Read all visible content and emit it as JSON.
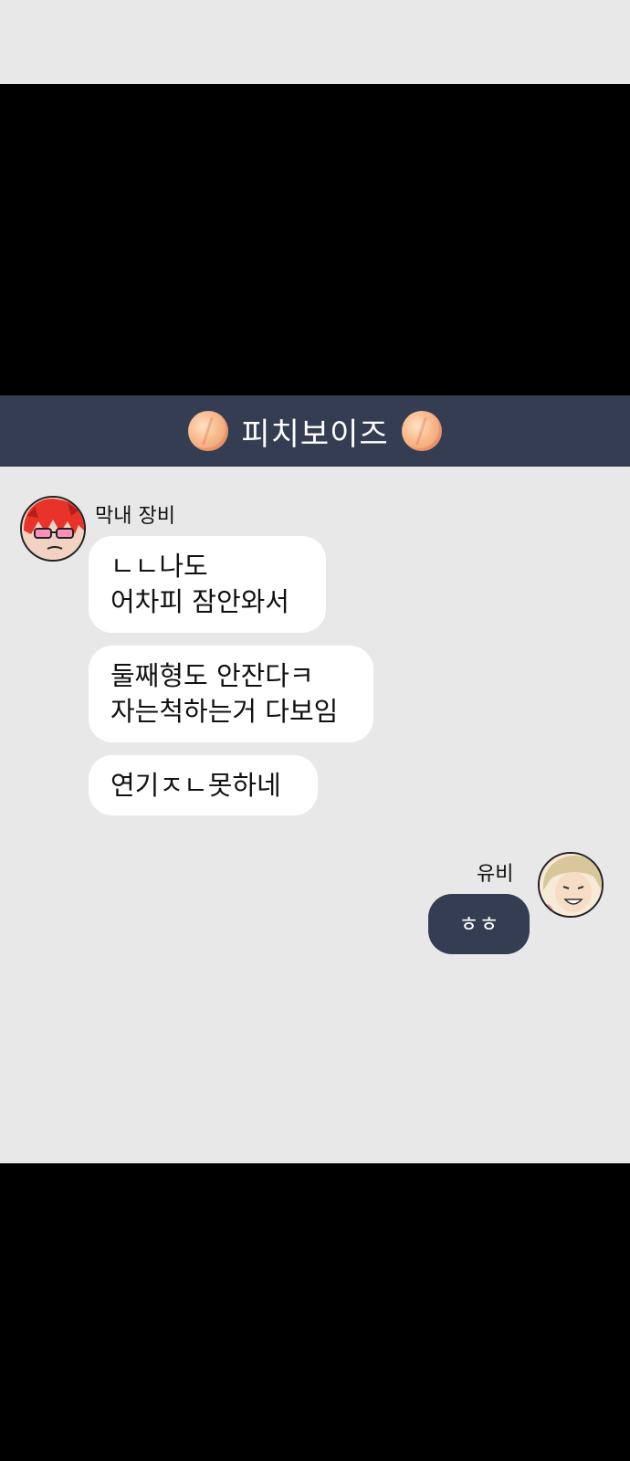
{
  "header": {
    "title": "피치보이즈",
    "icon_left": "peach-icon",
    "icon_right": "peach-icon",
    "background": "#353d52"
  },
  "messages": [
    {
      "sender": "막내 장비",
      "lines": [
        "ㄴㄴ나도",
        "어차피 잠안와서"
      ]
    },
    {
      "sender": "막내 장비",
      "lines": [
        "둘째형도 안잔다ㅋ",
        "자는척하는거 다보임"
      ]
    },
    {
      "sender": "막내 장비",
      "lines": [
        "연기ㅈㄴ못하네"
      ]
    },
    {
      "sender": "유비",
      "lines": [
        "ㅎㅎ"
      ]
    }
  ],
  "senders": {
    "left": "막내 장비",
    "right": "유비"
  },
  "colors": {
    "chat_background": "#e8e8e8",
    "incoming_bubble": "#ffffff",
    "outgoing_bubble": "#353d52"
  }
}
